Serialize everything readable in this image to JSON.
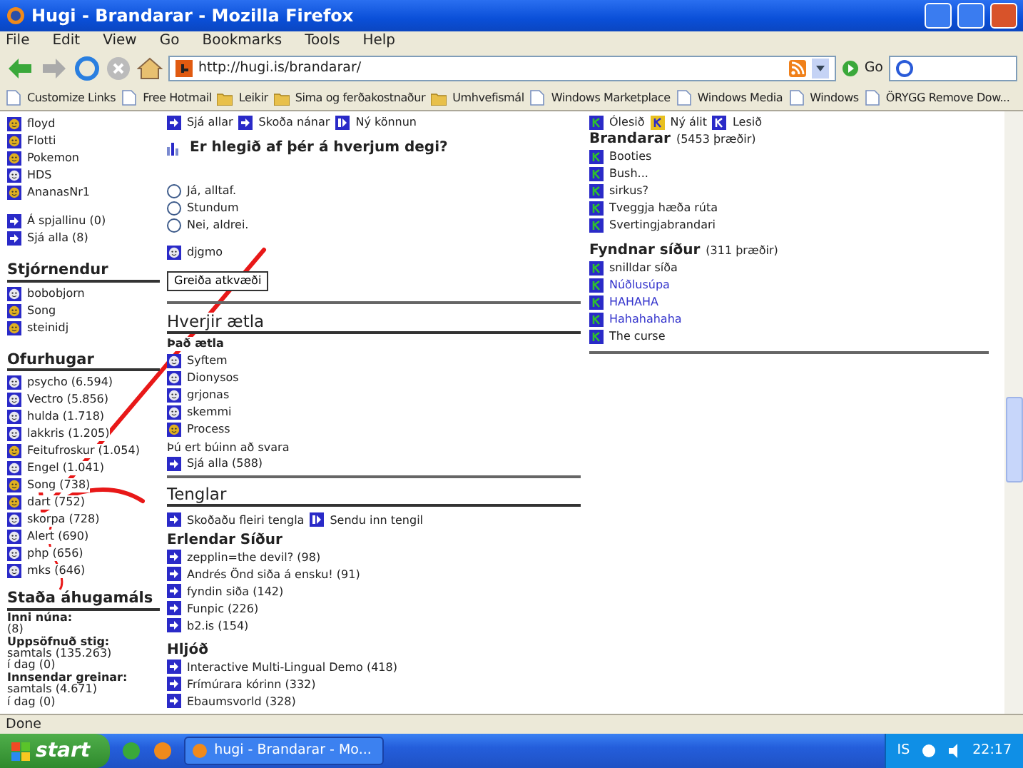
{
  "window": {
    "title": "Hugi - Brandarar - Mozilla Firefox"
  },
  "menu": [
    "File",
    "Edit",
    "View",
    "Go",
    "Bookmarks",
    "Tools",
    "Help"
  ],
  "toolbar": {
    "url": "http://hugi.is/brandarar/",
    "go_label": "Go"
  },
  "bookmarks": [
    {
      "label": "Customize Links",
      "kind": "page"
    },
    {
      "label": "Free Hotmail",
      "kind": "page"
    },
    {
      "label": "Leikir",
      "kind": "folder"
    },
    {
      "label": "Sima og ferðakostnaður",
      "kind": "folder"
    },
    {
      "label": "Umhvefismál",
      "kind": "folder"
    },
    {
      "label": "Windows Marketplace",
      "kind": "page"
    },
    {
      "label": "Windows Media",
      "kind": "page"
    },
    {
      "label": "Windows",
      "kind": "page"
    },
    {
      "label": "ÖRYGG  Remove Dow...",
      "kind": "page"
    }
  ],
  "left": {
    "users": [
      {
        "name": "floyd",
        "color": "#e0b020"
      },
      {
        "name": "Flotti",
        "color": "#e0b020"
      },
      {
        "name": "Pokemon",
        "color": "#e0b020"
      },
      {
        "name": "HDS",
        "color": "#e8e8f0"
      },
      {
        "name": "AnanasNr1",
        "color": "#e0b020"
      }
    ],
    "links": [
      "Á spjallinu (0)",
      "Sjá alla (8)"
    ],
    "groups": [
      {
        "title": "Stjórnendur",
        "users": [
          {
            "name": "bobobjorn",
            "color": "#e8e8f0"
          },
          {
            "name": "Song",
            "color": "#e0b020"
          },
          {
            "name": "steinidj",
            "color": "#e0b020"
          }
        ]
      },
      {
        "title": "Ofurhugar",
        "users": [
          {
            "name": "psycho (6.594)",
            "color": "#e8e8f0"
          },
          {
            "name": "Vectro (5.856)",
            "color": "#e8e8f0"
          },
          {
            "name": "hulda (1.718)",
            "color": "#e8e8f0"
          },
          {
            "name": "lakkris (1.205)",
            "color": "#e8e8f0"
          },
          {
            "name": "Feitufroskur (1.054)",
            "color": "#e0b020"
          },
          {
            "name": "Engel (1.041)",
            "color": "#e8e8f0"
          },
          {
            "name": "Song (738)",
            "color": "#e0b020"
          },
          {
            "name": "dart (752)",
            "color": "#e0b020"
          },
          {
            "name": "skorpa (728)",
            "color": "#e8e8f0"
          },
          {
            "name": "Alert (690)",
            "color": "#e8e8f0"
          },
          {
            "name": "php (656)",
            "color": "#e8e8f0"
          },
          {
            "name": "mks (646)",
            "color": "#e8e8f0"
          }
        ]
      }
    ],
    "stats": {
      "title": "Staða áhugamáls",
      "lines": [
        {
          "text": "Inni núna:",
          "bold": true
        },
        {
          "text": "(8)",
          "bold": false
        },
        {
          "text": "Uppsöfnuð stig:",
          "bold": true
        },
        {
          "text": "samtals (135.263)",
          "bold": false
        },
        {
          "text": "í dag (0)",
          "bold": false
        },
        {
          "text": "Innsendar greinar:",
          "bold": true
        },
        {
          "text": "samtals (4.671)",
          "bold": false
        },
        {
          "text": "í dag (0)",
          "bold": false
        }
      ]
    }
  },
  "middle": {
    "poll_links": [
      {
        "label": "Sjá allar",
        "kind": "arrow"
      },
      {
        "label": "Skoða nánar",
        "kind": "arrow"
      },
      {
        "label": "Ný könnun",
        "kind": "new"
      }
    ],
    "poll": {
      "question": "Er hlegið af þér á hverjum degi?",
      "options": [
        {
          "label": "Já, alltaf.",
          "selected": false
        },
        {
          "label": "Stundum",
          "selected": false
        },
        {
          "label": "Nei, aldrei.",
          "selected": false
        }
      ],
      "voter": {
        "name": "djgmo",
        "color": "#e8e8f0"
      },
      "button": "Greiða atkvæði"
    },
    "attending": {
      "title": "Hverjir ætla",
      "subtitle": "Það ætla",
      "users": [
        {
          "name": "Syftem",
          "color": "#e8e8f0"
        },
        {
          "name": "Dionysos",
          "color": "#e8e8f0"
        },
        {
          "name": "grjonas",
          "color": "#e8e8f0"
        },
        {
          "name": "skemmi",
          "color": "#e8e8f0"
        },
        {
          "name": "Process",
          "color": "#e0b020"
        }
      ],
      "answered": "Þú ert búinn að svara",
      "link": "Sjá alla (588)"
    },
    "links": {
      "title": "Tenglar",
      "actions": [
        {
          "label": "Skoðaðu fleiri tengla",
          "kind": "arrow"
        },
        {
          "label": "Sendu inn tengil",
          "kind": "new"
        }
      ],
      "groups": [
        {
          "title": "Erlendar Síður",
          "items": [
            "zepplin=the devil? (98)",
            "Andrés Önd siða á ensku! (91)",
            "fyndin siða (142)",
            "Funpic (226)",
            "b2.is (154)"
          ]
        },
        {
          "title": "Hljóð",
          "items": [
            "Interactive Multi-Lingual Demo (418)",
            "Frímúrara kórinn (332)",
            "Ebaumsvorld (328)"
          ]
        }
      ]
    }
  },
  "right": {
    "legend": [
      {
        "label": "Ólesið",
        "kind": "unread"
      },
      {
        "label": "Ný álit",
        "kind": "new"
      },
      {
        "label": "Lesið",
        "kind": "read"
      }
    ],
    "groups": [
      {
        "title": "Brandarar",
        "count": "(5453 þræðir)",
        "items": [
          {
            "label": "Booties",
            "visited": false
          },
          {
            "label": "Bush...",
            "visited": false
          },
          {
            "label": "sirkus?",
            "visited": false
          },
          {
            "label": "Tveggja hæða rúta",
            "visited": false
          },
          {
            "label": "Svertingjabrandari",
            "visited": false
          }
        ]
      },
      {
        "title": "Fyndnar síður",
        "count": "(311 þræðir)",
        "items": [
          {
            "label": "snilldar síða",
            "visited": false
          },
          {
            "label": "Núðlusúpa",
            "visited": true
          },
          {
            "label": "HAHAHA",
            "visited": true
          },
          {
            "label": "Hahahahaha",
            "visited": true
          },
          {
            "label": "The curse",
            "visited": false
          }
        ]
      }
    ]
  },
  "status_bar": "Done",
  "taskbar": {
    "start": "start",
    "task": "hugi - Brandarar - Mo...",
    "language": "IS",
    "clock": "22:17"
  }
}
